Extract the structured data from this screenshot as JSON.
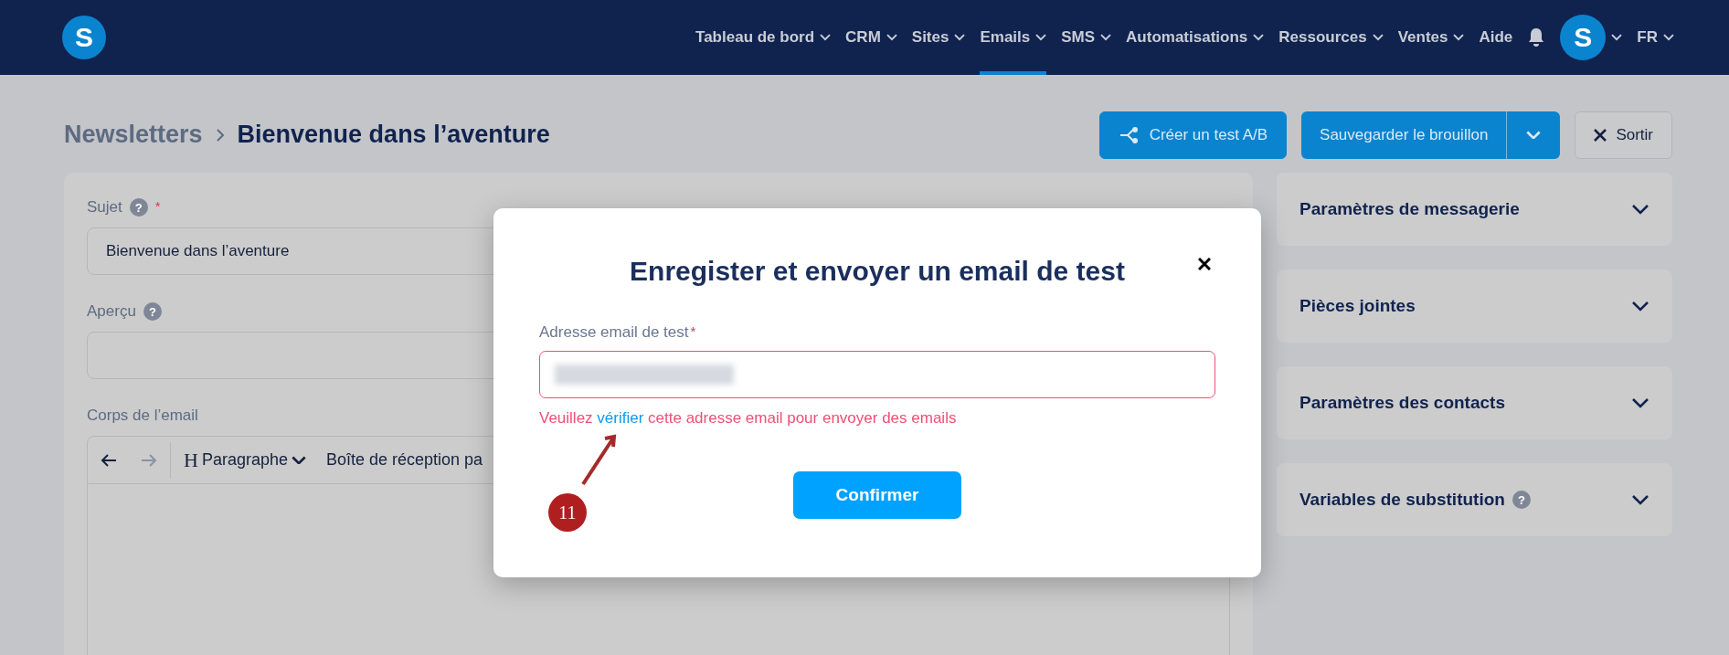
{
  "nav": {
    "logo": "S",
    "items": [
      {
        "label": "Tableau de bord",
        "caret": true,
        "selected": false
      },
      {
        "label": "CRM",
        "caret": true,
        "selected": false
      },
      {
        "label": "Sites",
        "caret": true,
        "selected": false
      },
      {
        "label": "Emails",
        "caret": true,
        "selected": true
      },
      {
        "label": "SMS",
        "caret": true,
        "selected": false
      },
      {
        "label": "Automatisations",
        "caret": true,
        "selected": false
      },
      {
        "label": "Ressources",
        "caret": true,
        "selected": false
      },
      {
        "label": "Ventes",
        "caret": true,
        "selected": false
      },
      {
        "label": "Aide",
        "caret": false,
        "selected": false
      }
    ],
    "avatar": "S",
    "language": "FR"
  },
  "breadcrumb": {
    "parent": "Newsletters",
    "current": "Bienvenue dans l’aventure"
  },
  "actions": {
    "ab_test": "Créer un test A/B",
    "save": "Sauvegarder le brouillon",
    "exit": "Sortir"
  },
  "form": {
    "subject": {
      "label": "Sujet",
      "help": "?",
      "required_mark": "*",
      "value": "Bienvenue dans l’aventure"
    },
    "preview": {
      "label": "Aperçu",
      "help": "?"
    },
    "body": {
      "label": "Corps de l’email",
      "toolbar": {
        "undo_disabled": false,
        "redo_disabled": true,
        "heading": "H",
        "format": "Paragraphe",
        "inbox": "Boîte de réception pa"
      }
    }
  },
  "side_panels": [
    {
      "title": "Paramètres de messagerie",
      "expanded": false
    },
    {
      "title": "Pièces jointes",
      "expanded": false
    },
    {
      "title": "Paramètres des contacts",
      "expanded": false
    },
    {
      "title": "Variables de substitution",
      "help": "?",
      "expanded": false
    }
  ],
  "modal": {
    "title": "Enregister et envoyer un email de test",
    "field_label": "Adresse email de test",
    "required_mark": "*",
    "invalid": true,
    "error": [
      {
        "text": "Veuillez ",
        "link": false
      },
      {
        "text": "vérifier",
        "link": true
      },
      {
        "text": " cette adresse email pour envoyer des emails",
        "link": false
      }
    ],
    "confirm": "Confirmer"
  },
  "annotation": {
    "label": "11"
  }
}
